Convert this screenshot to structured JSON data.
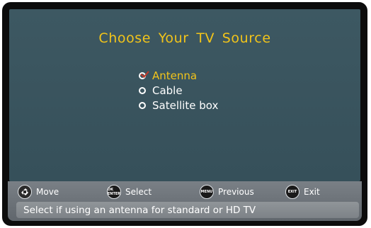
{
  "menu": {
    "title": "Choose Your TV Source",
    "options": [
      {
        "label": "Antenna",
        "selected": true
      },
      {
        "label": "Cable",
        "selected": false
      },
      {
        "label": "Satellite box",
        "selected": false
      }
    ]
  },
  "legend": {
    "move": {
      "icon": "dpad-icon",
      "label": "Move"
    },
    "select": {
      "icon": "ok-enter-button-icon",
      "icon_text": "OK ENTER",
      "label": "Select"
    },
    "previous": {
      "icon": "menu-button-icon",
      "icon_text": "MENU",
      "label": "Previous"
    },
    "exit": {
      "icon": "exit-button-icon",
      "icon_text": "EXIT",
      "label": "Exit"
    }
  },
  "status_text": "Select if using an antenna for standard or HD TV",
  "colors": {
    "title": "#f2c41a",
    "selected_option": "#f2c41a",
    "checkmark": "#c23a2a",
    "background": "#3d5862"
  }
}
